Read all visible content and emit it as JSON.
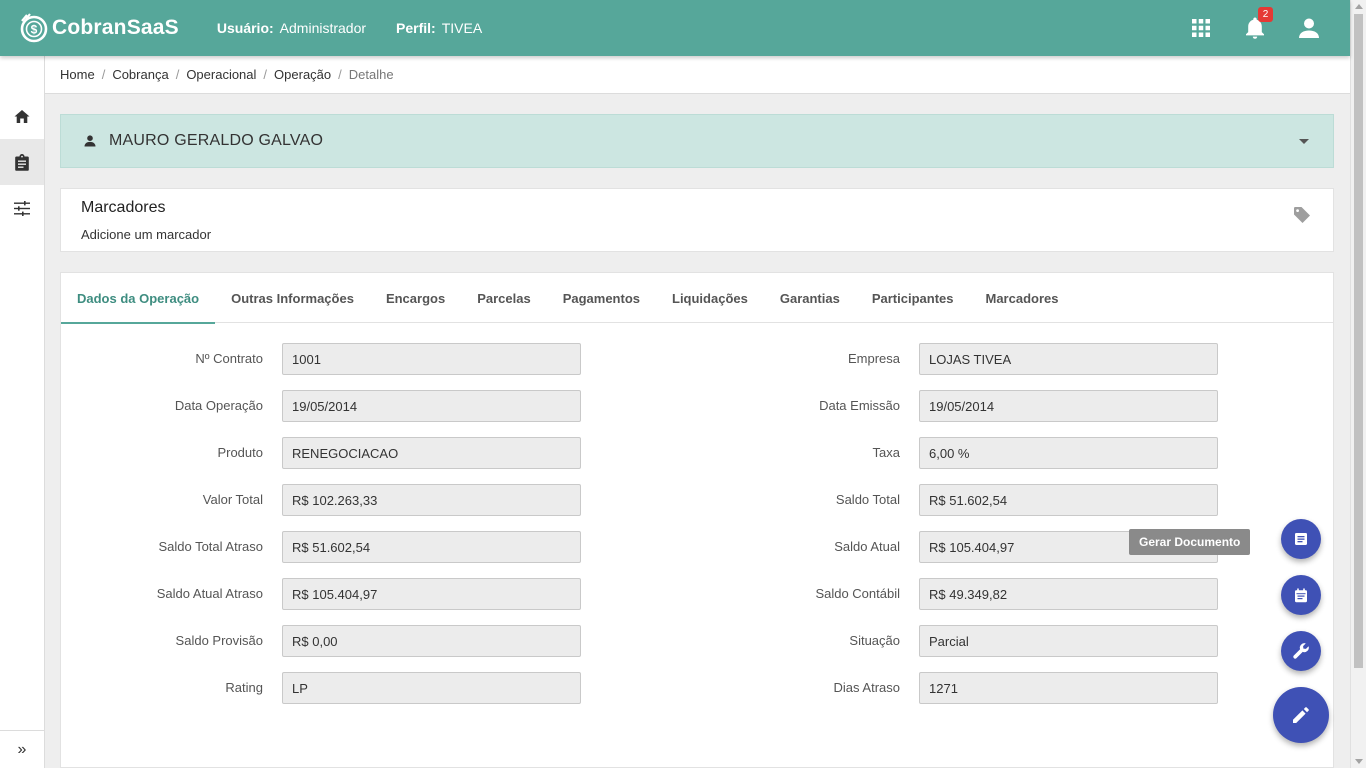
{
  "header": {
    "app_name": "CobranSaaS",
    "user_label": "Usuário:",
    "user_value": "Administrador",
    "profile_label": "Perfil:",
    "profile_value": "TIVEA",
    "notification_count": "2",
    "icons": [
      "apps-grid-icon",
      "bell-icon",
      "account-icon"
    ]
  },
  "sidebar": {
    "items": [
      "home-icon",
      "clipboard-icon",
      "sliders-icon"
    ],
    "expand_label": "»"
  },
  "breadcrumb": [
    "Home",
    "Cobrança",
    "Operacional",
    "Operação",
    "Detalhe"
  ],
  "person": {
    "name": "MAURO GERALDO GALVAO"
  },
  "markers": {
    "title": "Marcadores",
    "subtitle": "Adicione um marcador"
  },
  "tabs": [
    {
      "label": "Dados da Operação",
      "active": true
    },
    {
      "label": "Outras Informações"
    },
    {
      "label": "Encargos"
    },
    {
      "label": "Parcelas"
    },
    {
      "label": "Pagamentos"
    },
    {
      "label": "Liquidações"
    },
    {
      "label": "Garantias"
    },
    {
      "label": "Participantes"
    },
    {
      "label": "Marcadores"
    }
  ],
  "fields_left": [
    {
      "label": "Nº Contrato",
      "value": "1001"
    },
    {
      "label": "Data Operação",
      "value": "19/05/2014"
    },
    {
      "label": "Produto",
      "value": "RENEGOCIACAO"
    },
    {
      "label": "Valor Total",
      "value": "R$ 102.263,33"
    },
    {
      "label": "Saldo Total Atraso",
      "value": "R$ 51.602,54"
    },
    {
      "label": "Saldo Atual Atraso",
      "value": "R$ 105.404,97"
    },
    {
      "label": "Saldo Provisão",
      "value": "R$ 0,00"
    },
    {
      "label": "Rating",
      "value": "LP"
    }
  ],
  "fields_right": [
    {
      "label": "Empresa",
      "value": "LOJAS TIVEA"
    },
    {
      "label": "Data Emissão",
      "value": "19/05/2014"
    },
    {
      "label": "Taxa",
      "value": "6,00 %"
    },
    {
      "label": "Saldo Total",
      "value": "R$ 51.602,54"
    },
    {
      "label": "Saldo Atual",
      "value": "R$ 105.404,97"
    },
    {
      "label": "Saldo Contábil",
      "value": "R$ 49.349,82"
    },
    {
      "label": "Situação",
      "value": "Parcial"
    },
    {
      "label": "Dias Atraso",
      "value": "1271"
    }
  ],
  "fab": {
    "tooltip": "Gerar Documento",
    "actions": [
      "document-icon",
      "calendar-icon",
      "wrench-icon",
      "pencil-icon"
    ]
  },
  "colors": {
    "header": "#56a79a",
    "person_panel": "#cce6e1",
    "tab_active": "#3e8d80",
    "fab": "#3f51b5"
  }
}
